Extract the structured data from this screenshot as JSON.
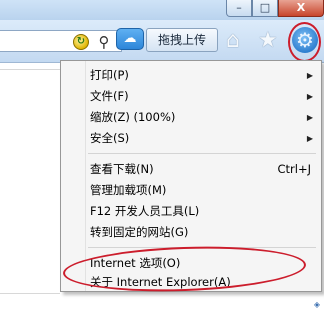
{
  "toolbar": {
    "upload_label": "拖拽上传",
    "icons": [
      "refresh-icon",
      "search-icon",
      "cloud-icon",
      "home-icon",
      "favorites-star-icon",
      "tools-gear-icon"
    ]
  },
  "window_buttons": {
    "minimize": "–",
    "maximize": "□",
    "close": "X"
  },
  "menu": {
    "items": [
      {
        "label": "打印(P)",
        "arrow": "▶"
      },
      {
        "label": "文件(F)",
        "arrow": "▶"
      },
      {
        "label": "缩放(Z) (100%)",
        "arrow": "▶"
      },
      {
        "label": "安全(S)",
        "arrow": "▶"
      },
      {
        "label": "查看下载(N)",
        "shortcut": "Ctrl+J"
      },
      {
        "label": "管理加载项(M)"
      },
      {
        "label": "F12 开发人员工具(L)"
      },
      {
        "label": "转到固定的网站(G)"
      },
      {
        "label": "Internet 选项(O)"
      },
      {
        "label": "关于 Internet Explorer(A)"
      }
    ]
  },
  "colors": {
    "highlight": "#cc1d2c",
    "menu_bg": "#f5f5f5",
    "toolbar_bg": "#c3d9f1"
  }
}
